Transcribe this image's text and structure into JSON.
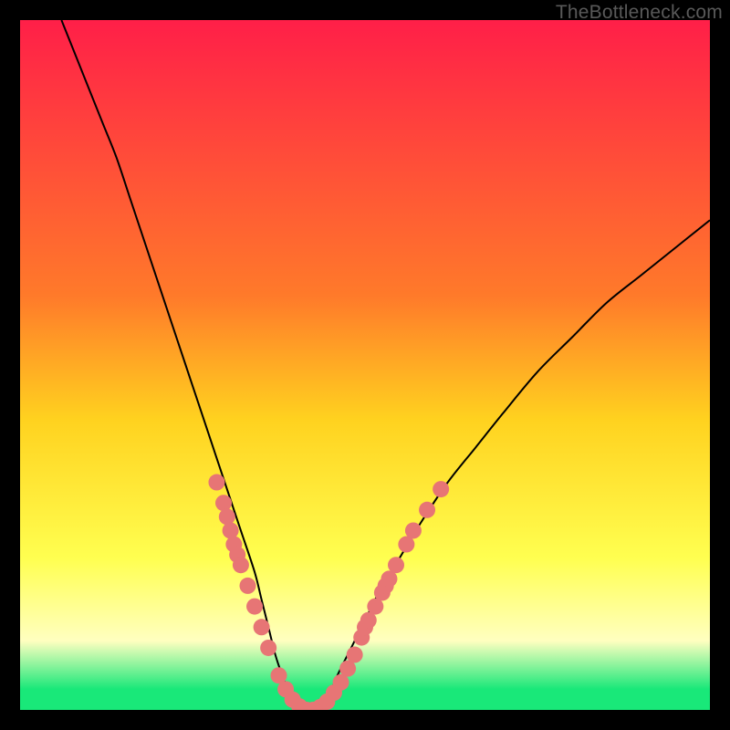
{
  "watermark": "TheBottleneck.com",
  "colors": {
    "gradient_top": "#ff1f48",
    "gradient_mid_upper": "#ff7a2a",
    "gradient_mid": "#ffd21f",
    "gradient_mid_lower": "#ffff50",
    "gradient_pale": "#ffffc0",
    "gradient_green": "#19e879",
    "curve": "#000000",
    "marker": "#e77575",
    "frame": "#000000"
  },
  "chart_data": {
    "type": "line",
    "title": "",
    "xlabel": "",
    "ylabel": "",
    "xlim": [
      0,
      100
    ],
    "ylim": [
      0,
      100
    ],
    "series": [
      {
        "name": "bottleneck-curve",
        "x": [
          6,
          8,
          10,
          12,
          14,
          16,
          18,
          20,
          22,
          24,
          26,
          28,
          30,
          32,
          34,
          35,
          36,
          37,
          38,
          39,
          40,
          41,
          42,
          43,
          44,
          45,
          46,
          48,
          50,
          52,
          55,
          58,
          62,
          66,
          70,
          75,
          80,
          85,
          90,
          95,
          100
        ],
        "y": [
          100,
          95,
          90,
          85,
          80,
          74,
          68,
          62,
          56,
          50,
          44,
          38,
          32,
          26,
          20,
          16,
          12,
          8,
          5,
          2.5,
          1,
          0.3,
          0,
          0.3,
          1,
          2.5,
          5,
          9,
          13,
          17,
          22,
          27,
          33,
          38,
          43,
          49,
          54,
          59,
          63,
          67,
          71
        ]
      }
    ],
    "markers": [
      {
        "x": 28.5,
        "y": 33
      },
      {
        "x": 29.5,
        "y": 30
      },
      {
        "x": 30.0,
        "y": 28
      },
      {
        "x": 30.5,
        "y": 26
      },
      {
        "x": 31.0,
        "y": 24
      },
      {
        "x": 31.5,
        "y": 22.5
      },
      {
        "x": 32.0,
        "y": 21
      },
      {
        "x": 33.0,
        "y": 18
      },
      {
        "x": 34.0,
        "y": 15
      },
      {
        "x": 35.0,
        "y": 12
      },
      {
        "x": 36.0,
        "y": 9
      },
      {
        "x": 37.5,
        "y": 5
      },
      {
        "x": 38.5,
        "y": 3
      },
      {
        "x": 39.5,
        "y": 1.5
      },
      {
        "x": 40.5,
        "y": 0.5
      },
      {
        "x": 41.5,
        "y": 0
      },
      {
        "x": 42.5,
        "y": 0
      },
      {
        "x": 43.5,
        "y": 0.4
      },
      {
        "x": 44.5,
        "y": 1.2
      },
      {
        "x": 45.5,
        "y": 2.5
      },
      {
        "x": 46.5,
        "y": 4
      },
      {
        "x": 47.5,
        "y": 6
      },
      {
        "x": 48.5,
        "y": 8
      },
      {
        "x": 49.5,
        "y": 10.5
      },
      {
        "x": 50.0,
        "y": 12
      },
      {
        "x": 50.5,
        "y": 13
      },
      {
        "x": 51.5,
        "y": 15
      },
      {
        "x": 52.5,
        "y": 17
      },
      {
        "x": 53.0,
        "y": 18
      },
      {
        "x": 53.5,
        "y": 19
      },
      {
        "x": 54.5,
        "y": 21
      },
      {
        "x": 56.0,
        "y": 24
      },
      {
        "x": 57.0,
        "y": 26
      },
      {
        "x": 59.0,
        "y": 29
      },
      {
        "x": 61.0,
        "y": 32
      }
    ],
    "gradient_stops": [
      {
        "offset": 0,
        "color_key": "gradient_top"
      },
      {
        "offset": 40,
        "color_key": "gradient_mid_upper"
      },
      {
        "offset": 58,
        "color_key": "gradient_mid"
      },
      {
        "offset": 78,
        "color_key": "gradient_mid_lower"
      },
      {
        "offset": 90,
        "color_key": "gradient_pale"
      },
      {
        "offset": 97,
        "color_key": "gradient_green"
      },
      {
        "offset": 100,
        "color_key": "gradient_green"
      }
    ]
  }
}
